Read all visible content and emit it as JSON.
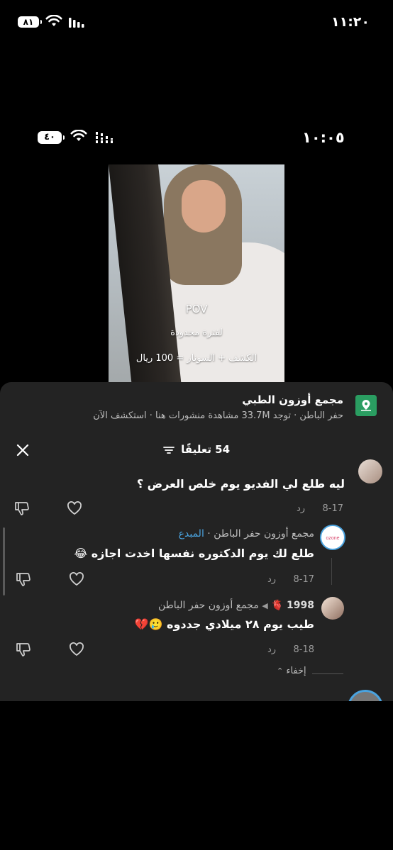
{
  "outer_status": {
    "time": "١١:٢٠",
    "battery": "٨١"
  },
  "inner_status": {
    "time": "١٠:٠٥",
    "battery": "٤٠"
  },
  "video": {
    "overlay_pov": "POV",
    "overlay_line1": "لفترة محدودة",
    "overlay_line2": "الكشف + السونار = 100 ريال"
  },
  "location": {
    "title": "مجمع أوزون الطبي",
    "subtitle": "حفر الباطن · توجد 33.7M مشاهدة منشورات هنا · استكشف الآن"
  },
  "comments_header": {
    "count_label": "54 تعليقًا"
  },
  "comments": [
    {
      "text": "ليه طلع لي الفديو يوم خلص العرض ؟",
      "date": "8-17",
      "reply": "رد"
    },
    {
      "author": "مجمع أوزون حفر الباطن",
      "badge": "المبدع",
      "text": "طلع لك يوم الدكتوره نفسها اخدت اجازه 😂",
      "date": "8-17",
      "reply": "رد"
    },
    {
      "author": "1998",
      "author_emoji": "🫀",
      "replying_to": "مجمع أوزون حفر الباطن",
      "text": "طيب يوم ٢٨ ميلادي جددوه 🥲💔",
      "date": "8-18",
      "reply": "رد"
    }
  ],
  "hide_label": "إخفاء",
  "colors": {
    "sheet_bg": "#232323",
    "location_icon": "#2a9d61",
    "creator_badge": "#4aa3df"
  }
}
